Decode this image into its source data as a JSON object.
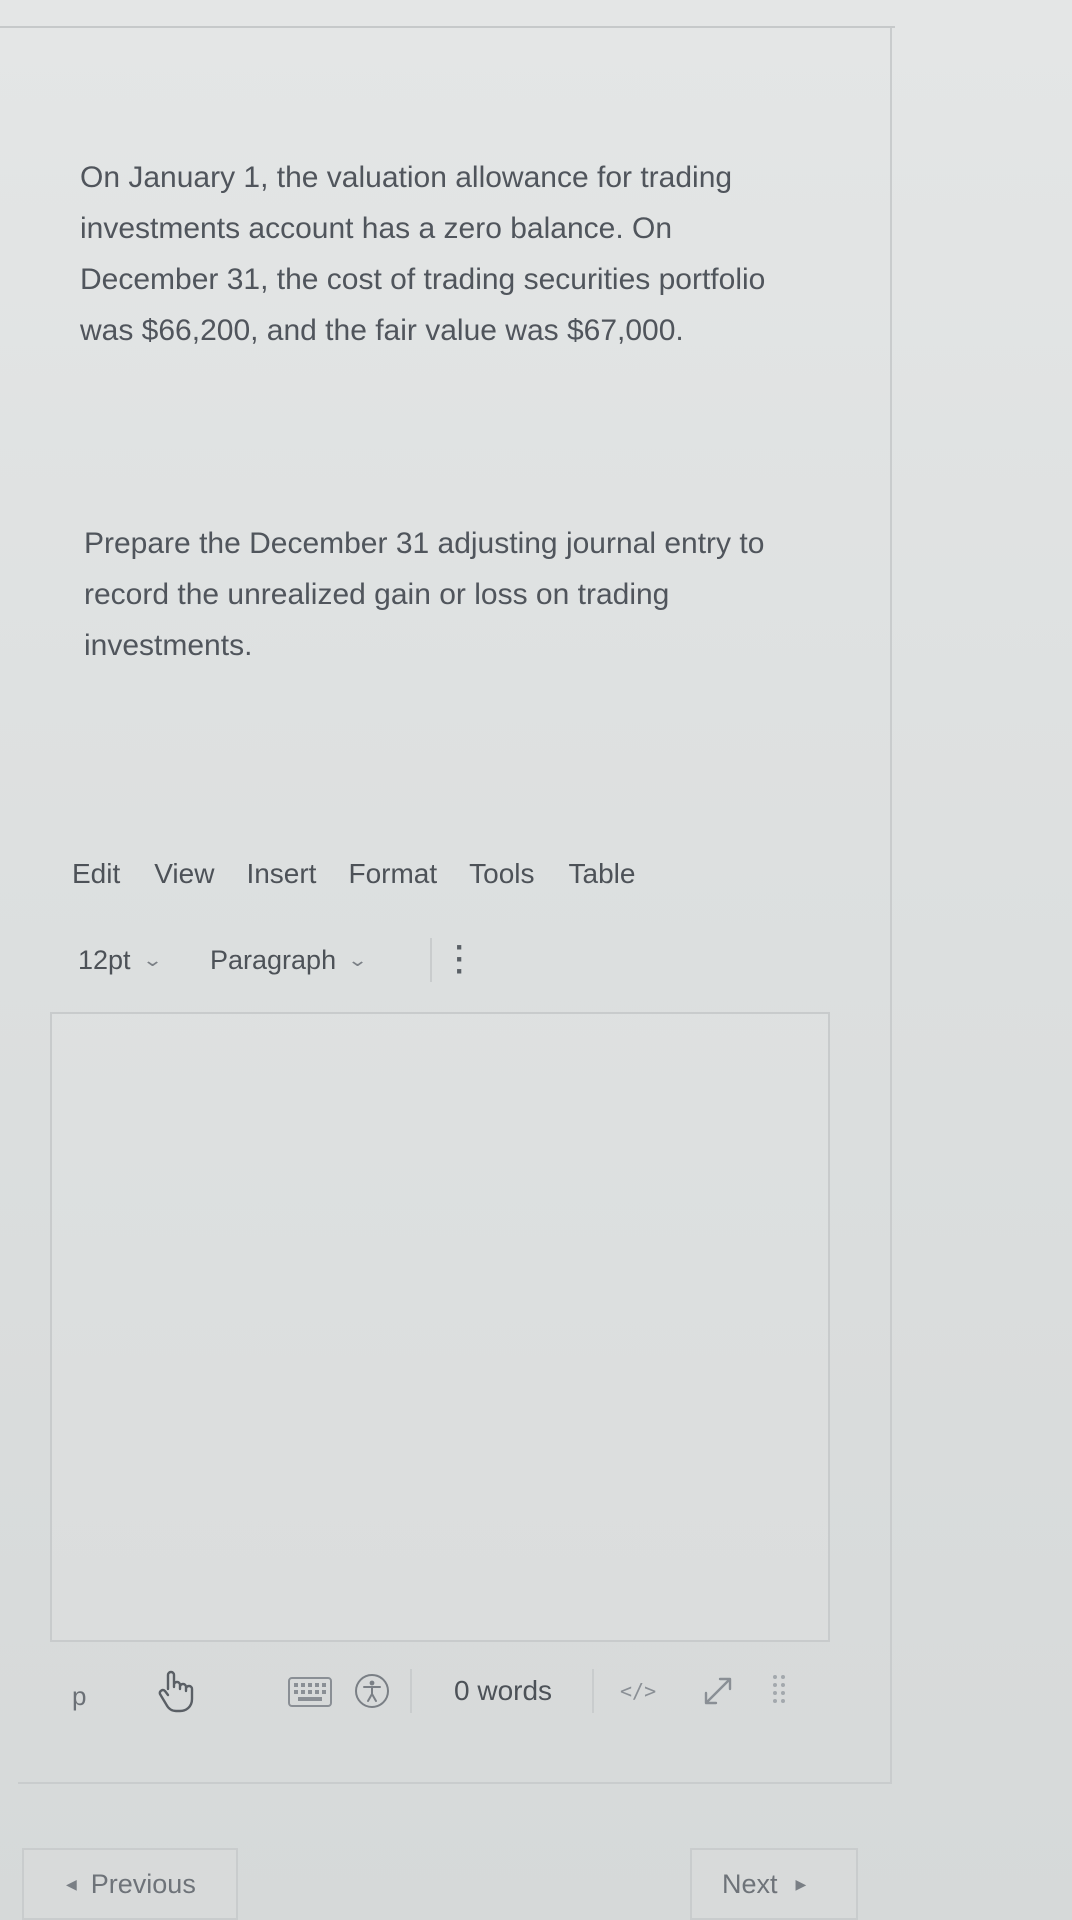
{
  "question": {
    "paragraph_1": "On January 1, the valuation allowance for trading investments account has a zero balance.  On December 31, the cost of trading securities portfolio was $66,200, and the fair value was $67,000.",
    "paragraph_2": "Prepare the December 31 adjusting journal entry to record the unrealized gain or loss on trading investments."
  },
  "editor": {
    "menu": [
      "Edit",
      "View",
      "Insert",
      "Format",
      "Tools",
      "Table"
    ],
    "font_size": "12pt",
    "block_format": "Paragraph",
    "element_path": "p",
    "word_count": "0 words",
    "code_label": "</>"
  },
  "navigation": {
    "previous_label": "Previous",
    "next_label": "Next"
  },
  "icons": {
    "more": "more-vertical-icon",
    "hand": "hand-pointer-icon",
    "keyboard": "keyboard-icon",
    "accessibility": "accessibility-icon",
    "code": "code-icon",
    "fullscreen": "expand-icon",
    "resize": "resize-handle-icon"
  }
}
